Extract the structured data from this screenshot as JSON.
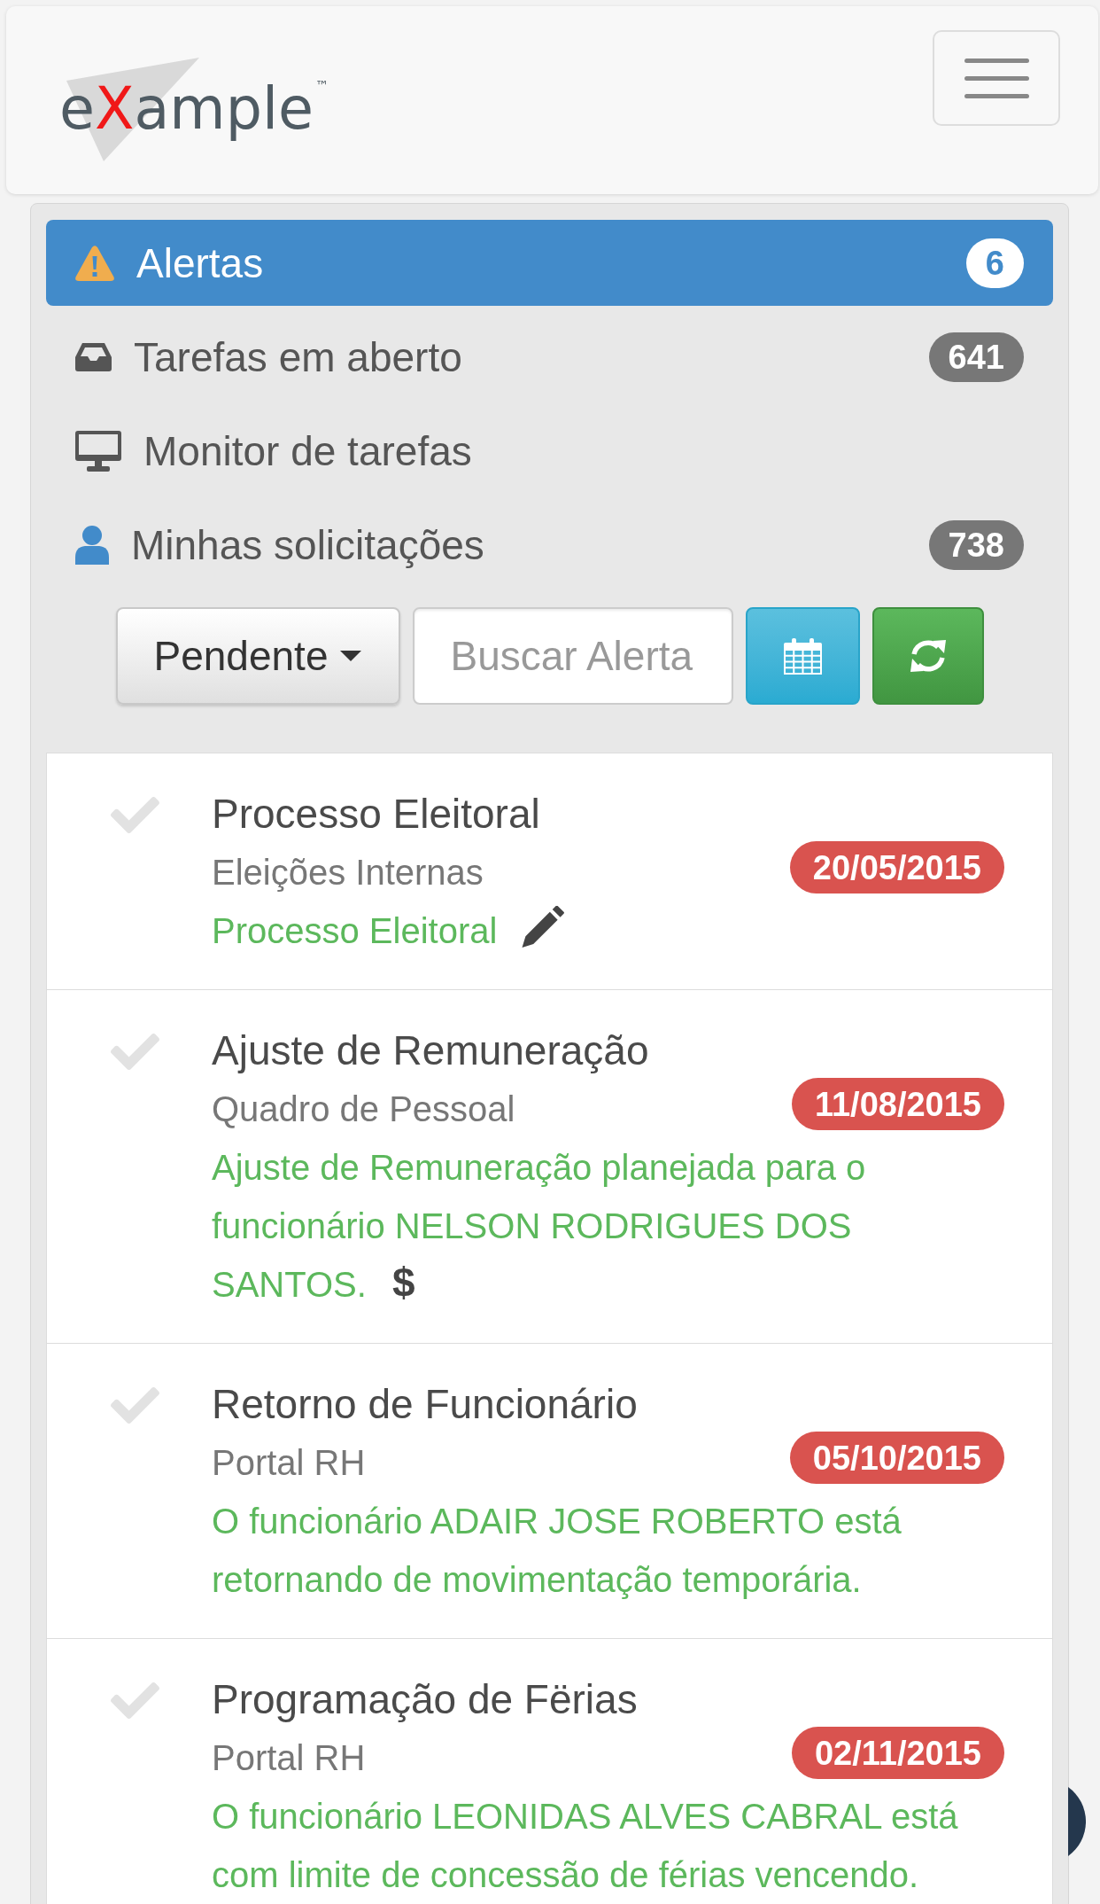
{
  "header": {
    "logo": {
      "segments": [
        {
          "text": "e",
          "accent": false
        },
        {
          "text": "X",
          "accent": true
        },
        {
          "text": "ample",
          "accent": false
        }
      ],
      "trademark": "™"
    }
  },
  "nav": {
    "items": [
      {
        "kind": "warning",
        "label": "Alertas",
        "badge": "6",
        "selected": true
      },
      {
        "kind": "inbox",
        "label": "Tarefas em aberto",
        "badge": "641",
        "selected": false
      },
      {
        "kind": "monitor",
        "label": "Monitor de tarefas",
        "selected": false
      },
      {
        "kind": "user",
        "label": "Minhas solicitações",
        "badge": "738",
        "selected": false
      }
    ]
  },
  "toolbar": {
    "status_filter": {
      "label": "Pendente"
    },
    "search": {
      "placeholder": "Buscar Alerta"
    },
    "buttons": [
      {
        "kind": "calendar"
      },
      {
        "kind": "refresh"
      }
    ]
  },
  "alerts": [
    {
      "checked": false,
      "title": "Processo Eleitoral",
      "source": "Eleições Internas",
      "date": "20/05/2015",
      "message": "Processo Eleitoral",
      "editable": true
    },
    {
      "checked": false,
      "title": "Ajuste de Remuneração",
      "source": "Quadro de Pessoal",
      "date": "11/08/2015",
      "message": "Ajuste de Remuneração planejada para o funcionário NELSON RODRIGUES DOS SANTOS. **$**",
      "editable": false
    },
    {
      "checked": false,
      "title": "Retorno de Funcionário",
      "source": "Portal RH",
      "date": "05/10/2015",
      "message": "O funcionário ADAIR JOSE ROBERTO está retornando de movimentação temporária.",
      "editable": false
    },
    {
      "checked": false,
      "title": "Programação de Fërias",
      "source": "Portal RH",
      "date": "02/11/2015",
      "message": "O funcionário LEONIDAS ALVES CABRAL está com limite de concessão de férias vencendo.",
      "editable": false
    }
  ]
}
